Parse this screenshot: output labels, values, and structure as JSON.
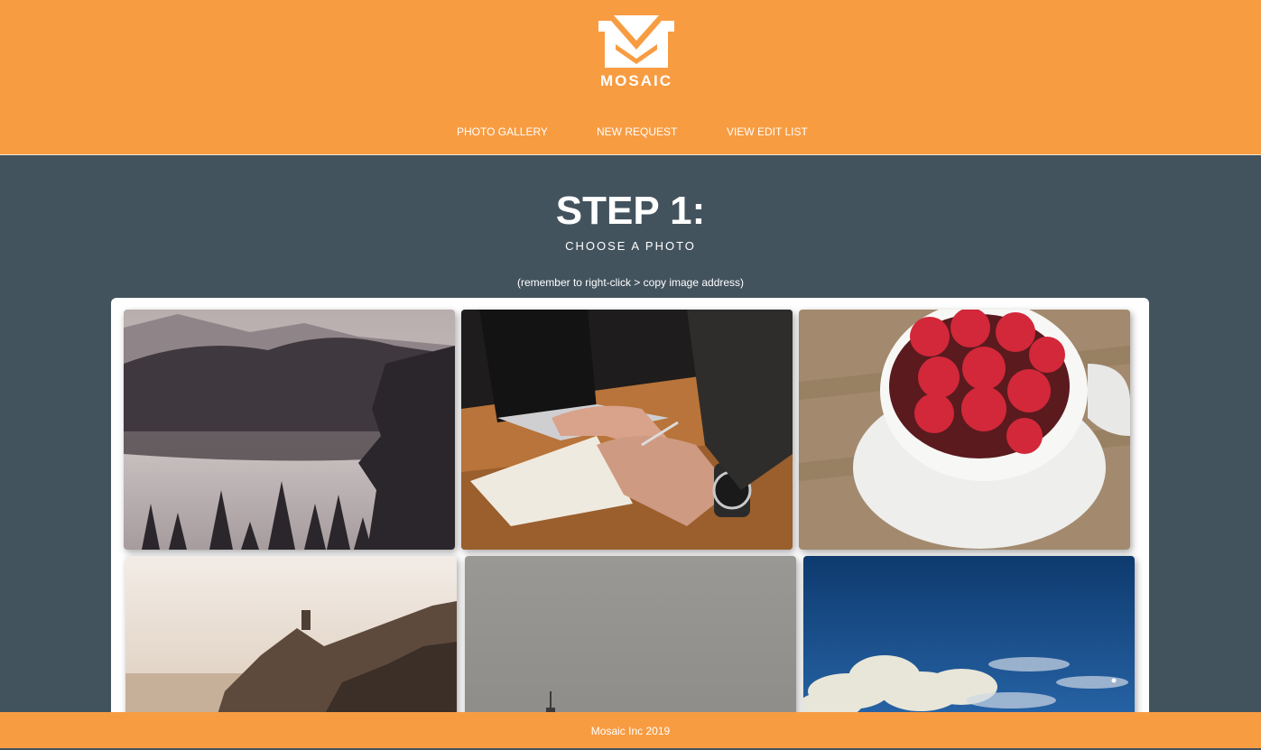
{
  "brand": {
    "name": "MOSAIC",
    "logo_icon": "mosaic-m-logo-icon",
    "color": "#f89c42"
  },
  "nav": {
    "items": [
      {
        "label": "PHOTO GALLERY"
      },
      {
        "label": "NEW REQUEST"
      },
      {
        "label": "VIEW EDIT LIST"
      }
    ]
  },
  "main": {
    "title": "STEP 1:",
    "subtitle": "CHOOSE A PHOTO",
    "hint": "(remember to right-click > copy image address)",
    "background": "#43535e"
  },
  "gallery": {
    "photos": [
      {
        "subject": "misty forest lake"
      },
      {
        "subject": "hand writing in notebook by laptop"
      },
      {
        "subject": "cup of raspberries"
      },
      {
        "subject": "coastal cliffs at sunset"
      },
      {
        "subject": "grey foggy sea"
      },
      {
        "subject": "clouds in deep blue sky"
      }
    ]
  },
  "footer": {
    "text": "Mosaic Inc 2019"
  }
}
